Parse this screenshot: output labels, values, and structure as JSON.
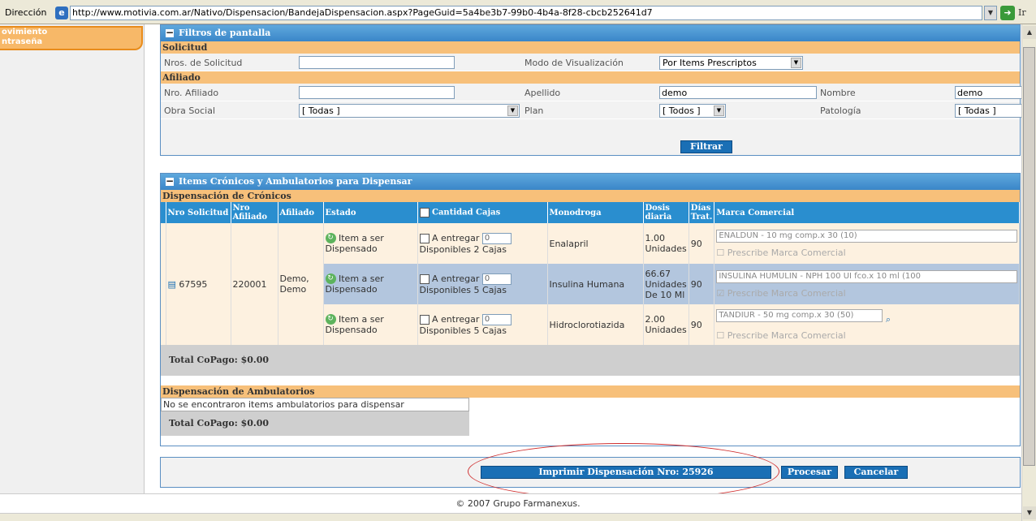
{
  "address_bar": {
    "label": "Dirección",
    "url": "http://www.motivia.com.ar/Nativo/Dispensacion/BandejaDispensacion.aspx?PageGuid=5a4be3b7-99b0-4b4a-8f28-cbcb252641d7",
    "go": "Ir"
  },
  "leftnav": {
    "line1": "ovimiento",
    "line2": "ntraseña"
  },
  "filters": {
    "title": "Filtros de pantalla",
    "solicitud_section": "Solicitud",
    "nros_solicitud_label": "Nros. de Solicitud",
    "nros_solicitud_value": "",
    "modo_label": "Modo de Visualización",
    "modo_value": "Por Items Prescriptos",
    "afiliado_section": "Afiliado",
    "nro_afiliado_label": "Nro. Afiliado",
    "nro_afiliado_value": "",
    "apellido_label": "Apellido",
    "apellido_value": "demo",
    "nombre_label": "Nombre",
    "nombre_value": "demo",
    "obra_label": "Obra Social",
    "obra_value": "[ Todas ]",
    "plan_label": "Plan",
    "plan_value": "[ Todos ]",
    "patologia_label": "Patología",
    "patologia_value": "[ Todas ]",
    "filtrar": "Filtrar"
  },
  "items": {
    "title": "Items Crónicos y Ambulatorios para Dispensar",
    "cronicos_section": "Dispensación de Crónicos",
    "headers": {
      "nro_sol": "Nro Solicitud",
      "nro_af": "Nro Afiliado",
      "afiliado": "Afiliado",
      "estado": "Estado",
      "cantidad": "Cantidad Cajas",
      "monodroga": "Monodroga",
      "dosis": "Dosis diaria",
      "dias": "Días Trat.",
      "marca": "Marca Comercial"
    },
    "solicitud": "67595",
    "afiliado_nro": "220001",
    "afiliado_nombre": "Demo, Demo",
    "rows": [
      {
        "estado": "Item a ser Dispensado",
        "entregar_label": "A entregar",
        "entregar_value": "0",
        "disponibles": "Disponibles 2 Cajas",
        "monodroga": "Enalapril",
        "dosis": "1.00 Unidades",
        "dias": "90",
        "marca": "ENALDUN - 10 mg comp.x 30 (10)",
        "prescribe": "Prescribe Marca Comercial"
      },
      {
        "estado": "Item a ser Dispensado",
        "entregar_label": "A entregar",
        "entregar_value": "0",
        "disponibles": "Disponibles 5 Cajas",
        "monodroga": "Insulina Humana",
        "dosis": "66.67 Unidades De 10 Ml",
        "dias": "90",
        "marca": "INSULINA HUMULIN - NPH 100 UI fco.x 10 ml (100",
        "prescribe": "Prescribe Marca Comercial"
      },
      {
        "estado": "Item a ser Dispensado",
        "entregar_label": "A entregar",
        "entregar_value": "0",
        "disponibles": "Disponibles 5 Cajas",
        "monodroga": "Hidroclorotiazida",
        "dosis": "2.00 Unidades",
        "dias": "90",
        "marca": "TANDIUR - 50 mg comp.x 30 (50)",
        "prescribe": "Prescribe Marca Comercial"
      }
    ],
    "total1": "Total CoPago: $0.00",
    "ambulatorios_section": "Dispensación de Ambulatorios",
    "no_items": "No se encontraron items ambulatorios para dispensar",
    "total2": "Total CoPago: $0.00"
  },
  "actions": {
    "imprimir": "Imprimir Dispensación Nro: 25926",
    "procesar": "Procesar",
    "cancelar": "Cancelar"
  },
  "footer": "© 2007 Grupo Farmanexus."
}
